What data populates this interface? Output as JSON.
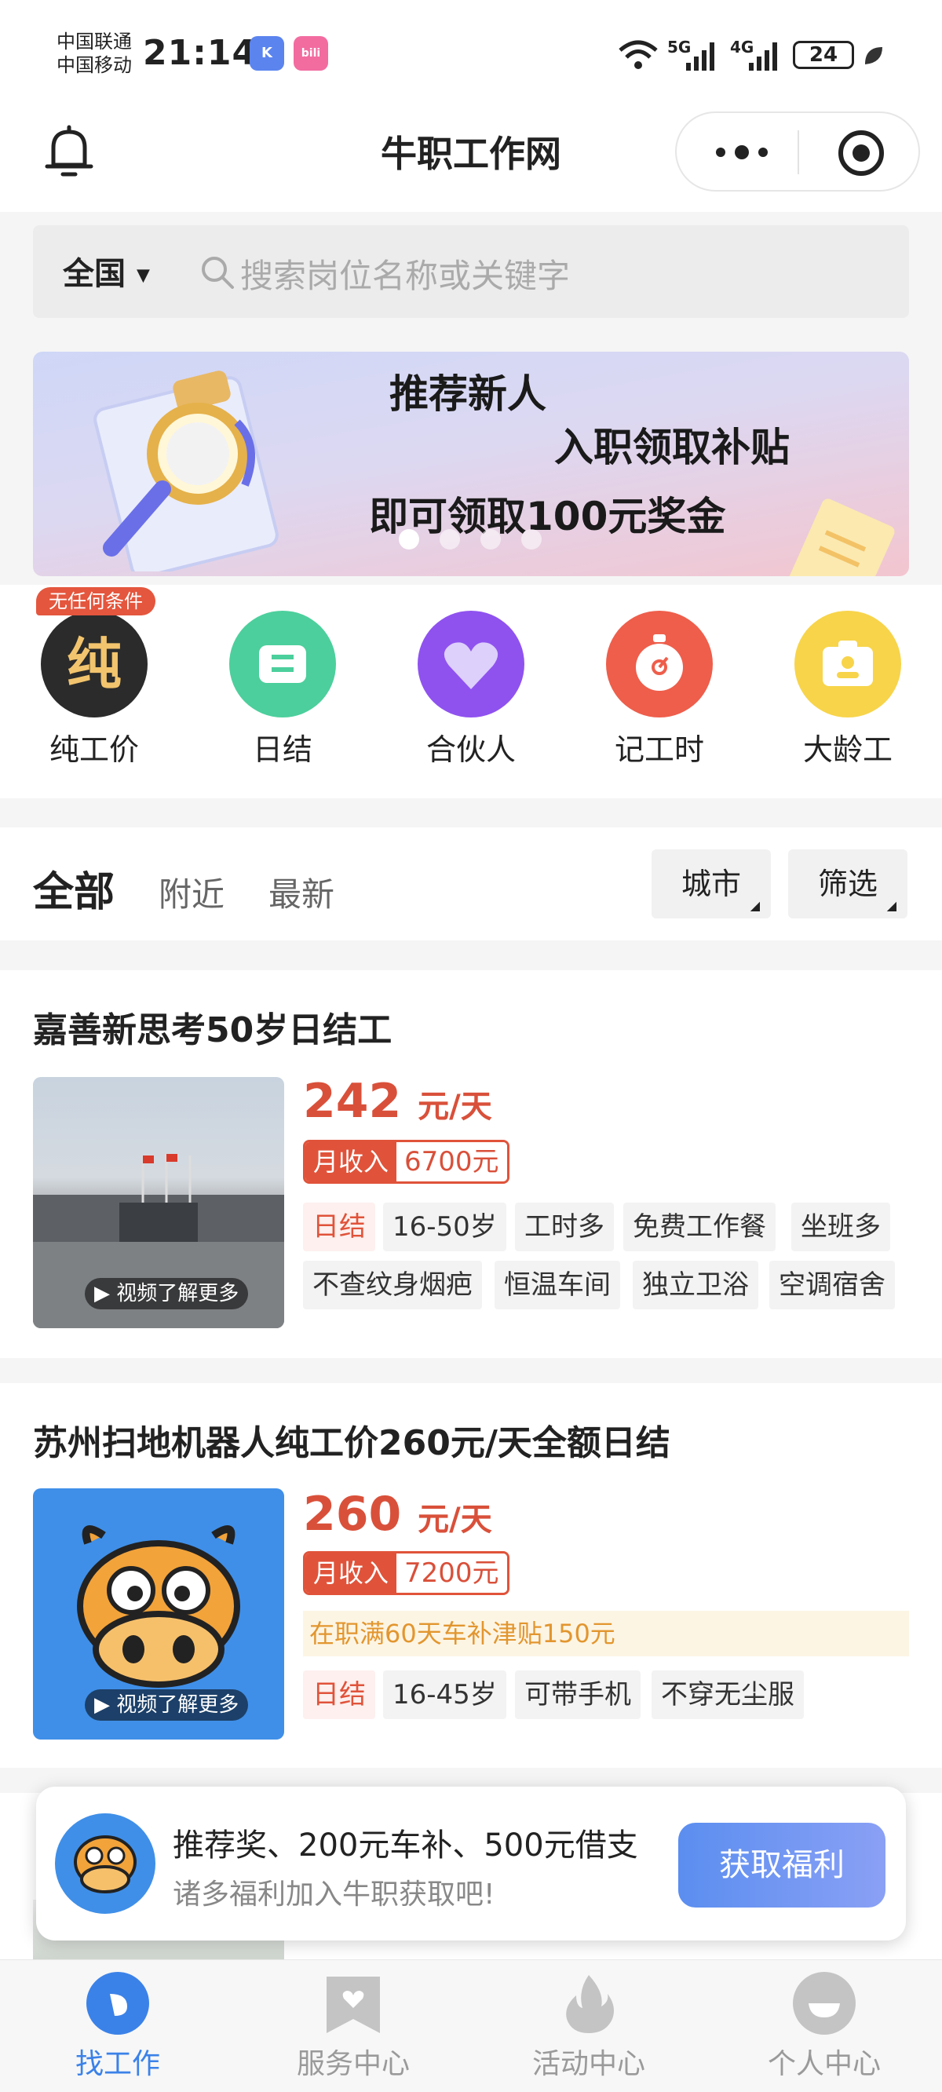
{
  "status_bar": {
    "carrier_1": "中国联通",
    "carrier_2": "中国移动",
    "time": "21:14",
    "network_1": "5G",
    "network_2": "4G",
    "battery": "24"
  },
  "header": {
    "title": "牛职工作网"
  },
  "search": {
    "region": "全国",
    "placeholder": "搜索岗位名称或关键字"
  },
  "banner": {
    "line1": "推荐新人",
    "line2": "入职领取补贴",
    "line3": "即可领取100元奖金",
    "active_dot": 0
  },
  "categories": {
    "badge": "无任何条件",
    "items": [
      {
        "label": "纯工价",
        "glyph": "纯",
        "color": "#2b2b2b"
      },
      {
        "label": "日结",
        "color": "#4ccf9c"
      },
      {
        "label": "合伙人",
        "color": "#8f52ef"
      },
      {
        "label": "记工时",
        "color": "#ee5e4b"
      },
      {
        "label": "大龄工",
        "color": "#f7d44a"
      }
    ]
  },
  "tabs": {
    "all": "全部",
    "nearby": "附近",
    "latest": "最新",
    "city": "城市",
    "filter": "筛选"
  },
  "jobs": [
    {
      "title": "嘉善新思考50岁日结工",
      "price": "242",
      "unit": "元/天",
      "month_label": "月收入",
      "month_value": "6700元",
      "video": "视频了解更多",
      "tags_row1": [
        "日结",
        "16-50岁",
        "工时多",
        "免费工作餐",
        "坐班多"
      ],
      "tags_row2": [
        "不查纹身烟疤",
        "恒温车间",
        "独立卫浴",
        "空调宿舍"
      ]
    },
    {
      "title": "苏州扫地机器人纯工价260元/天全额日结",
      "price": "260",
      "unit": "元/天",
      "month_label": "月收入",
      "month_value": "7200元",
      "perk": "在职满60天车补津贴150元",
      "video": "视频了解更多",
      "tags_row1": [
        "日结",
        "16-45岁",
        "可带手机",
        "不穿无尘服"
      ]
    }
  ],
  "popup": {
    "line1": "推荐奖、200元车补、500元借支",
    "line2": "诸多福利加入牛职获取吧!",
    "button": "获取福利"
  },
  "bottom_nav": [
    {
      "label": "找工作",
      "active": true
    },
    {
      "label": "服务中心",
      "active": false
    },
    {
      "label": "活动中心",
      "active": false
    },
    {
      "label": "个人中心",
      "active": false
    }
  ],
  "colors": {
    "accent_red": "#d9503a",
    "active_blue": "#3b82e8",
    "button_gradient": [
      "#5b8ef0",
      "#8aa0f5"
    ]
  }
}
